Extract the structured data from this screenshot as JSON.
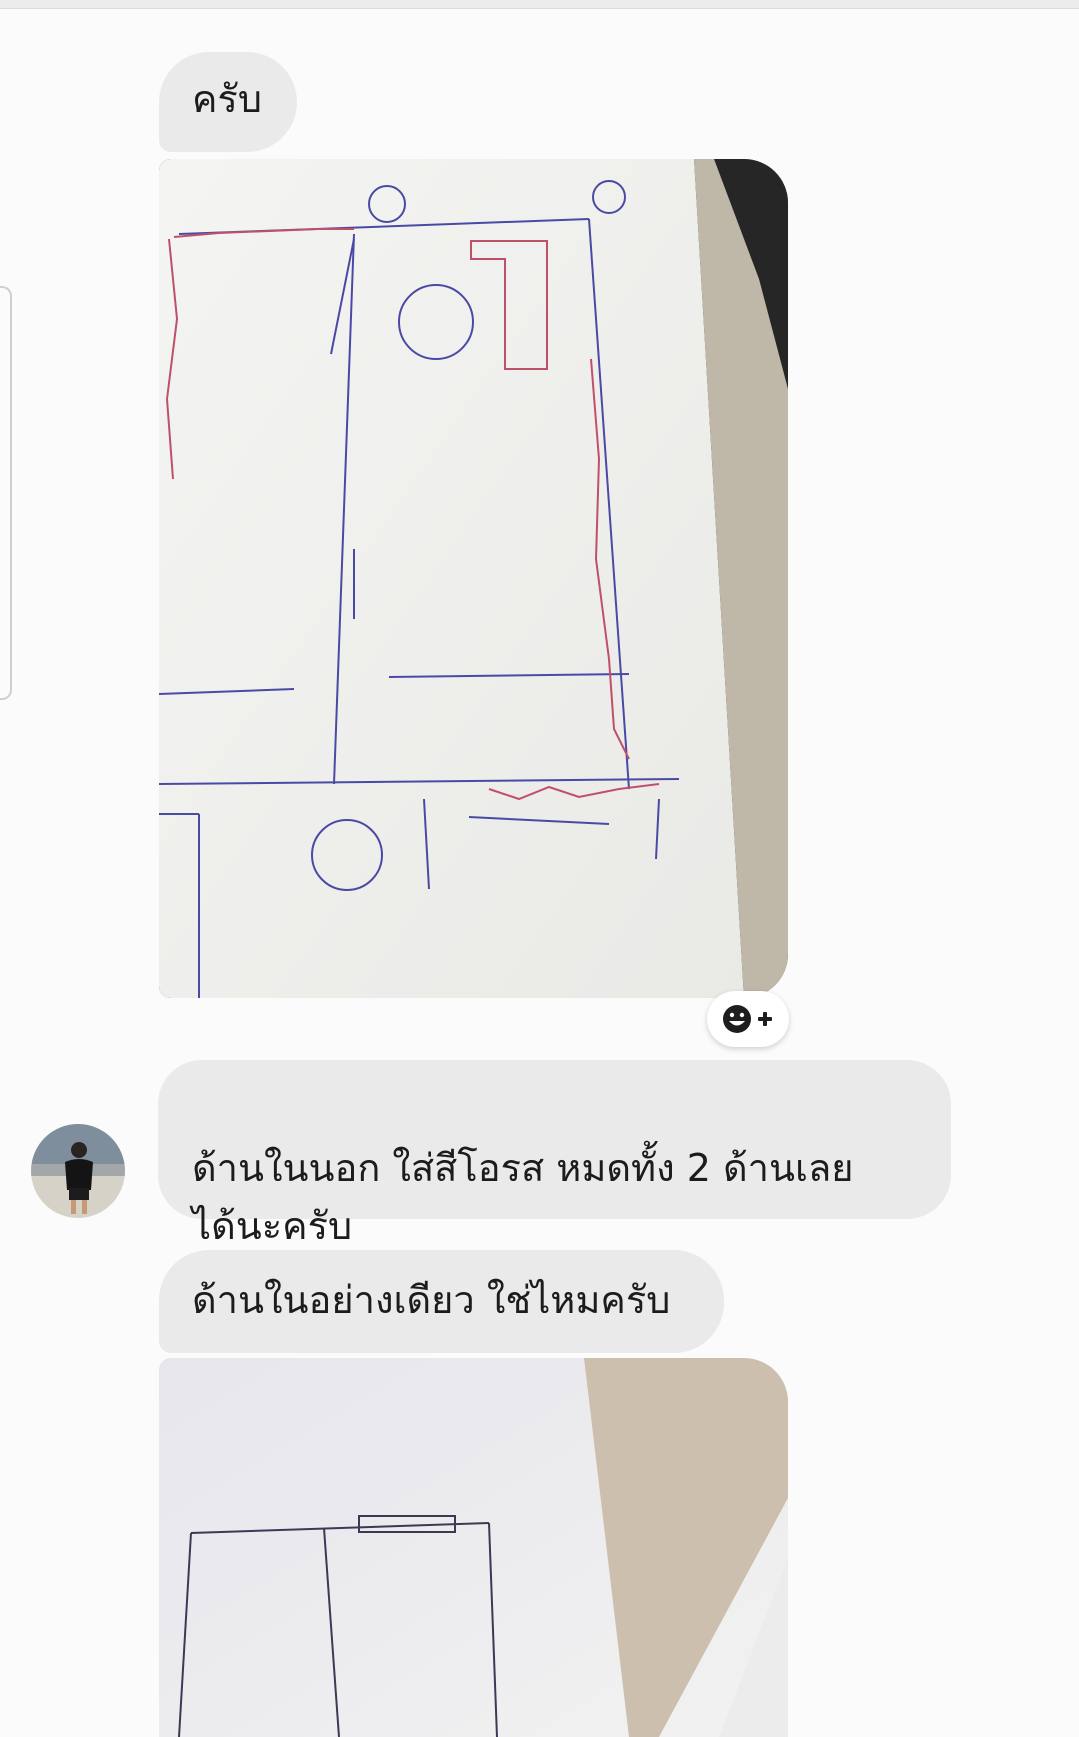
{
  "messages": [
    {
      "text": "ครับ"
    },
    {
      "text": "ด้านในนอก ใส่สีโอรส หมดทั้ง 2 ด้านเลย\nได้นะครับ"
    },
    {
      "text": "ด้านในอย่างเดียว ใช่ไหมครับ"
    }
  ],
  "reaction": {
    "icon": "emoji-add-icon"
  },
  "colors": {
    "bubble": "#eaeaea",
    "background": "#fbfbfb",
    "sketch_pen": "#4a4aa6",
    "sketch_red": "#c0506a"
  }
}
